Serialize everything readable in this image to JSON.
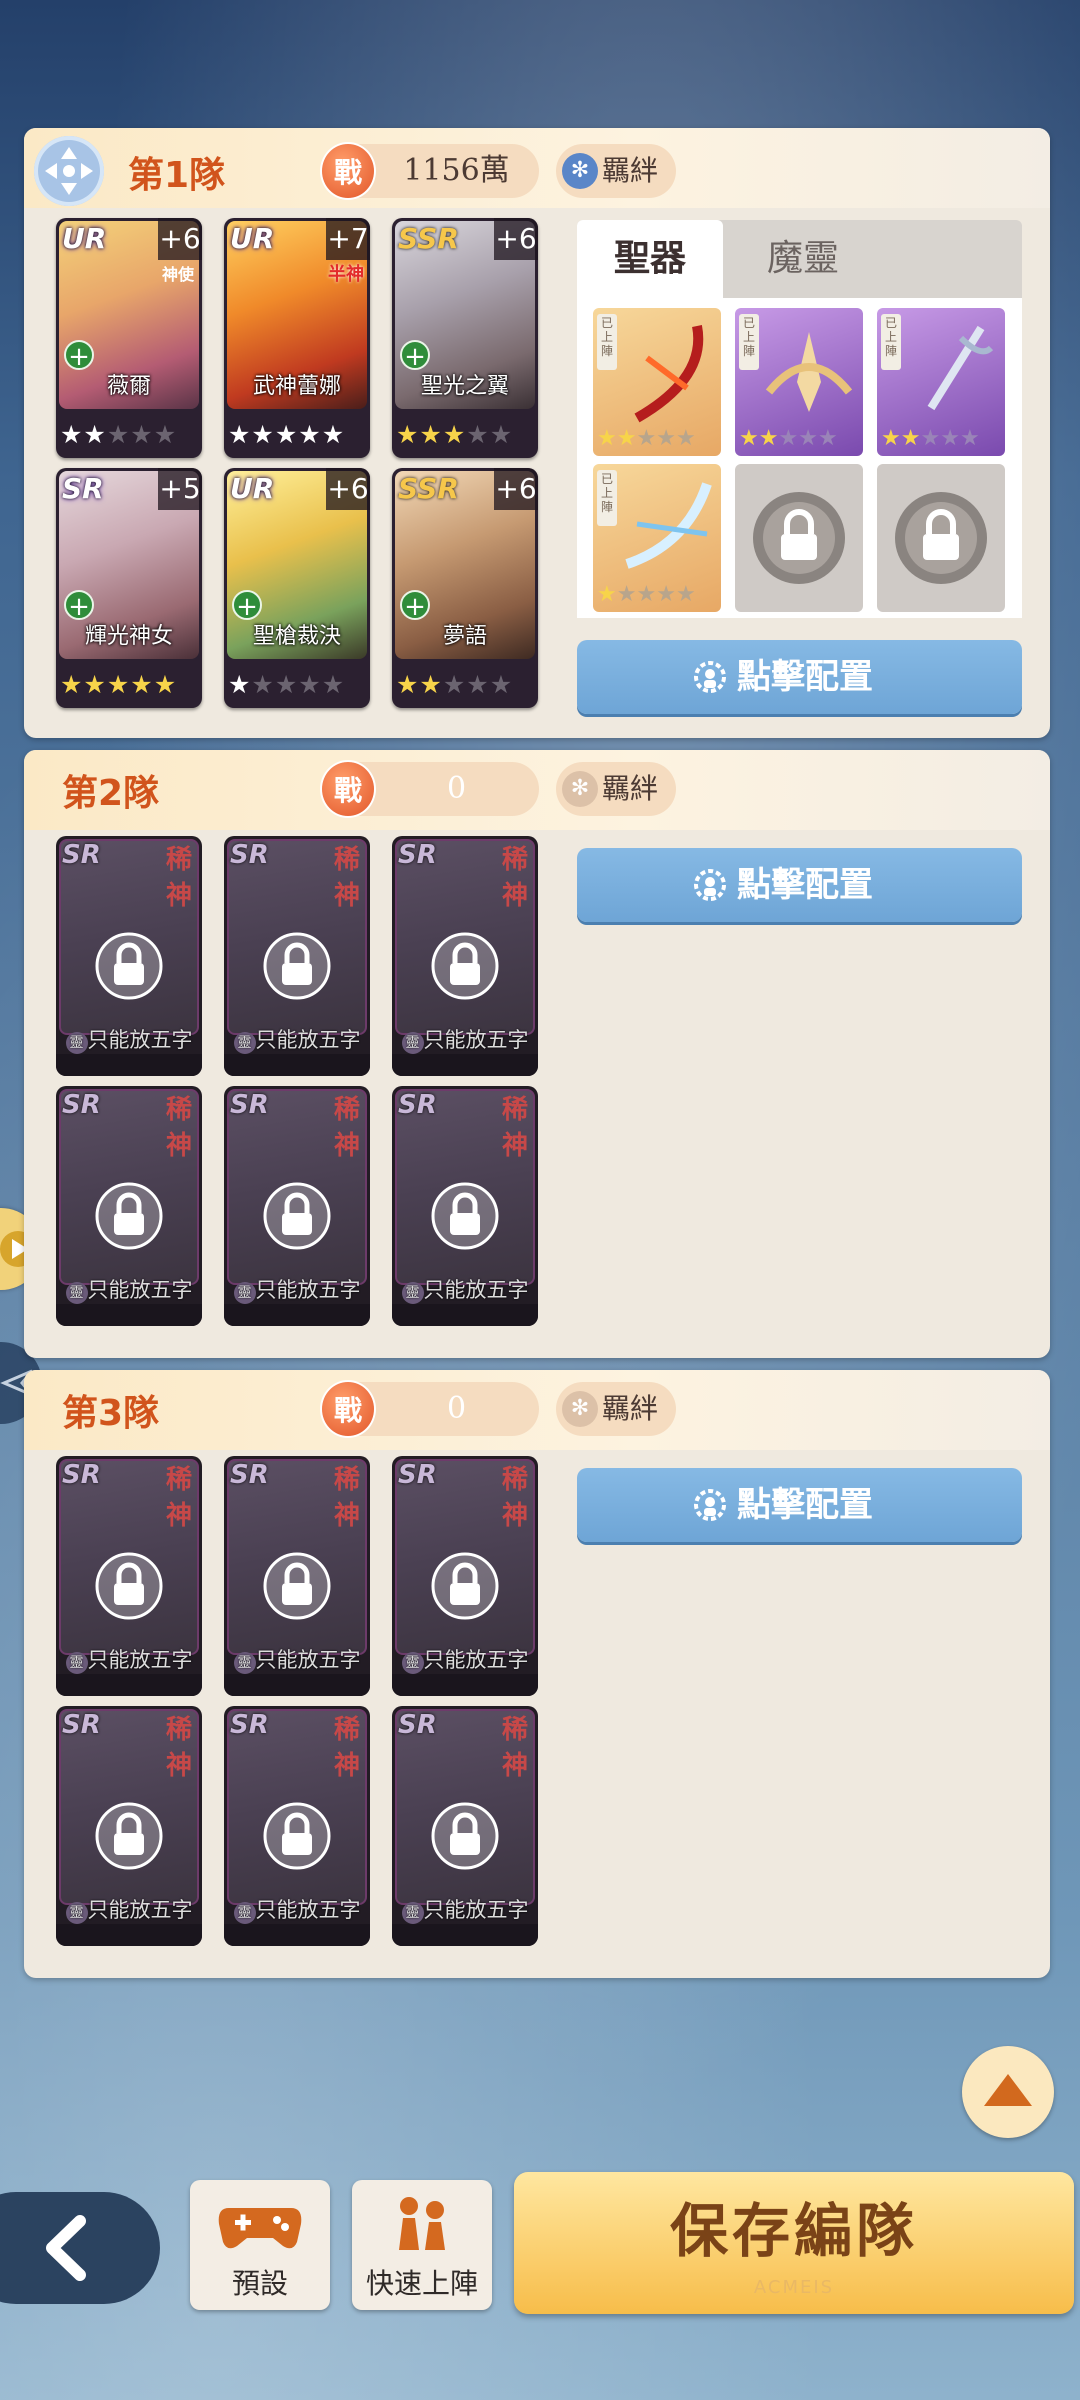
{
  "teams": [
    {
      "title": "第1隊",
      "power": "1156萬",
      "bond_label": "羈絆",
      "characters": [
        {
          "rarity": "UR",
          "plus": "+6",
          "name": "薇爾",
          "tag": "神使",
          "stars_lit": 2,
          "star_color": "white"
        },
        {
          "rarity": "UR",
          "plus": "+7",
          "name": "武神蕾娜",
          "tag": "半神",
          "stars_lit": 5,
          "star_color": "white"
        },
        {
          "rarity": "SSR",
          "plus": "+6",
          "name": "聖光之翼",
          "tag": "",
          "stars_lit": 3,
          "star_color": "gold"
        },
        {
          "rarity": "SR",
          "plus": "+5",
          "name": "輝光神女",
          "tag": "",
          "stars_lit": 5,
          "star_color": "gold"
        },
        {
          "rarity": "UR",
          "plus": "+6",
          "name": "聖槍裁決",
          "tag": "",
          "stars_lit": 1,
          "star_color": "white"
        },
        {
          "rarity": "SSR",
          "plus": "+6",
          "name": "夢語",
          "tag": "",
          "stars_lit": 2,
          "star_color": "gold"
        }
      ],
      "equipment_tabs": [
        "聖器",
        "魔靈"
      ],
      "equipment": [
        {
          "slot": "filled",
          "badge": "已上陣",
          "stars_lit": 2
        },
        {
          "slot": "filled",
          "badge": "已上陣",
          "stars_lit": 2
        },
        {
          "slot": "filled",
          "badge": "已上陣",
          "stars_lit": 2
        },
        {
          "slot": "filled",
          "badge": "已上陣",
          "stars_lit": 1
        },
        {
          "slot": "locked"
        },
        {
          "slot": "locked"
        }
      ],
      "config_label": "點擊配置"
    },
    {
      "title": "第2隊",
      "power": "0",
      "bond_label": "羈絆",
      "config_label": "點擊配置"
    },
    {
      "title": "第3隊",
      "power": "0",
      "bond_label": "羈絆",
      "config_label": "點擊配置"
    }
  ],
  "locked_slot": {
    "rarity": "SR",
    "seal_top": "稀",
    "seal_bottom": "神",
    "caption": "只能放五字",
    "caption_badge": "靈"
  },
  "power_icon_label": "戰",
  "bottom_bar": {
    "preset_label": "預設",
    "quick_label": "快速上陣",
    "save_label": "保存編隊",
    "save_sub": "ACMEIS"
  },
  "colors": {
    "team_title": "#d1541c",
    "config_button": "#6ea5d6",
    "save_button": "#f7bd4a"
  }
}
